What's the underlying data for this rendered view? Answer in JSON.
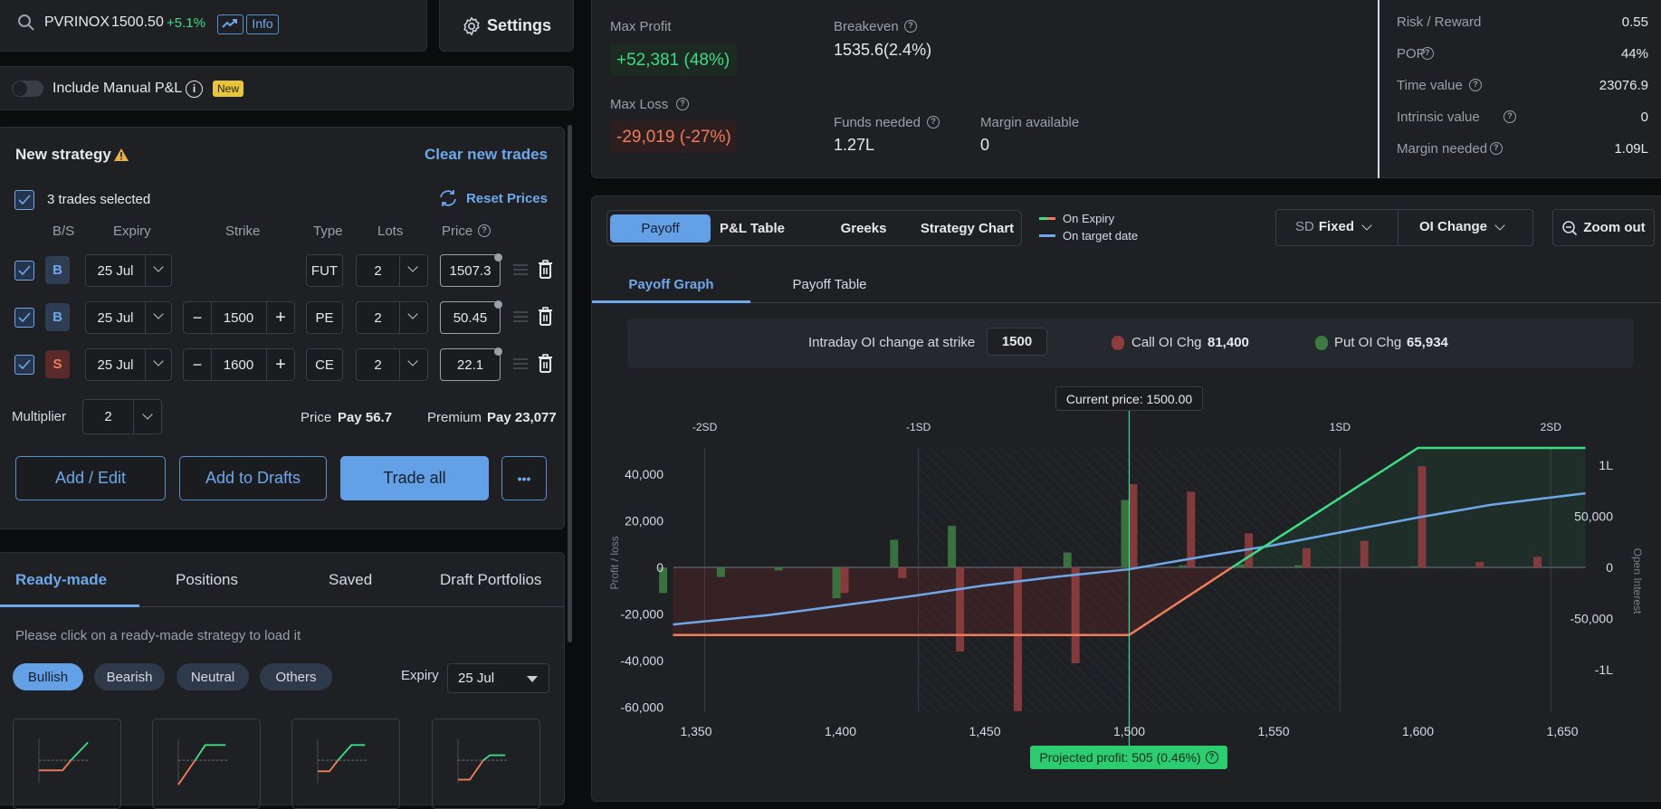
{
  "search": {
    "symbol": "PVRINOX",
    "price": "1500.50",
    "change": "+5.1%",
    "info_label": "Info"
  },
  "settings": {
    "label": "Settings"
  },
  "manual_pl": {
    "label": "Include Manual P&L",
    "badge": "New",
    "enabled": false
  },
  "strategy": {
    "title": "New strategy",
    "clear_label": "Clear new trades",
    "selected_label": "3 trades selected",
    "reset_label": "Reset Prices",
    "headers": [
      "B/S",
      "Expiry",
      "Strike",
      "Type",
      "Lots",
      "Price"
    ],
    "legs": [
      {
        "side": "B",
        "expiry": "25 Jul",
        "strike": "",
        "type": "FUT",
        "lots": "2",
        "price": "1507.3"
      },
      {
        "side": "B",
        "expiry": "25 Jul",
        "strike": "1500",
        "type": "PE",
        "lots": "2",
        "price": "50.45"
      },
      {
        "side": "S",
        "expiry": "25 Jul",
        "strike": "1600",
        "type": "CE",
        "lots": "2",
        "price": "22.1"
      }
    ],
    "multiplier_label": "Multiplier",
    "multiplier": "2",
    "price_label": "Price",
    "price_value": "Pay 56.7",
    "premium_label": "Premium",
    "premium_value": "Pay 23,077",
    "buttons": {
      "add_edit": "Add / Edit",
      "drafts": "Add to Drafts",
      "trade_all": "Trade all",
      "more": "•••"
    }
  },
  "readymade": {
    "tabs": [
      "Ready-made",
      "Positions",
      "Saved",
      "Draft Portfolios"
    ],
    "active_tab": 0,
    "hint": "Please click on a ready-made strategy to load it",
    "filters": [
      "Bullish",
      "Bearish",
      "Neutral",
      "Others"
    ],
    "active_filter": 0,
    "expiry_label": "Expiry",
    "expiry_value": "25 Jul"
  },
  "stats": {
    "max_profit_label": "Max Profit",
    "max_profit": "+52,381 (48%)",
    "max_loss_label": "Max Loss",
    "max_loss": "-29,019 (-27%)",
    "breakeven_label": "Breakeven",
    "breakeven": "1535.6(2.4%)",
    "funds_label": "Funds needed",
    "funds": "1.27L",
    "margin_avail_label": "Margin available",
    "margin_avail": "0",
    "right": [
      {
        "label": "Risk / Reward",
        "value": "0.55",
        "help": false
      },
      {
        "label": "POP",
        "value": "44%",
        "help": true
      },
      {
        "label": "Time value",
        "value": "23076.9",
        "help": true
      },
      {
        "label": "Intrinsic value",
        "value": "0",
        "help": true
      },
      {
        "label": "Margin needed",
        "value": "1.09L",
        "help": true
      }
    ]
  },
  "chart_panel": {
    "tabs": [
      "Payoff",
      "P&L Table",
      "Greeks",
      "Strategy Chart"
    ],
    "active_tab": 0,
    "legend": [
      "On Expiry",
      "On target date"
    ],
    "sd_prefix": "SD",
    "sd_value": "Fixed",
    "oi_mode": "OI Change",
    "zoom_label": "Zoom out",
    "subtabs": [
      "Payoff Graph",
      "Payoff Table"
    ],
    "active_subtab": 0,
    "oi_bar": {
      "label": "Intraday OI change at strike",
      "strike": "1500",
      "call_label": "Call OI Chg",
      "call_value": "81,400",
      "put_label": "Put OI Chg",
      "put_value": "65,934"
    },
    "current_price_label": "Current price: 1500.00",
    "projected_label": "Projected profit: 505 (0.46%)"
  },
  "colors": {
    "accent": "#6ea8ea",
    "profit": "#3ddc84",
    "loss": "#f07c5a",
    "target": "#6ea8ea",
    "call_oi": "#8e3d3f",
    "put_oi": "#3c7a41"
  },
  "chart_data": {
    "type": "line",
    "title": "Payoff Graph",
    "xlabel": "",
    "ylabel": "Profit / loss",
    "y2label": "Open Interest",
    "xlim": [
      1342,
      1658
    ],
    "ylim": [
      -62000,
      48000
    ],
    "y2lim": [
      -120000,
      95000
    ],
    "x_ticks": [
      1350,
      1400,
      1450,
      1500,
      1550,
      1600,
      1650
    ],
    "x_tick_labels": [
      "1,350",
      "1,400",
      "1,450",
      "1,500",
      "1,550",
      "1,600",
      "1,650"
    ],
    "y_ticks": [
      40000,
      20000,
      0,
      -20000,
      -40000,
      -60000
    ],
    "y_tick_labels": [
      "40,000",
      "20,000",
      "0",
      "-20,000",
      "-40,000",
      "-60,000"
    ],
    "y2_ticks": [
      100000,
      50000,
      0,
      -50000,
      -100000
    ],
    "y2_tick_labels": [
      "1L",
      "50,000",
      "0",
      "-50,000",
      "-1L"
    ],
    "sd_markers": [
      {
        "label": "-2SD",
        "x": 1353
      },
      {
        "label": "-1SD",
        "x": 1427
      },
      {
        "label": "1SD",
        "x": 1573
      },
      {
        "label": "2SD",
        "x": 1646
      }
    ],
    "current_price": 1500,
    "grid": true,
    "legend_position": "top",
    "series": [
      {
        "name": "On Expiry",
        "points": [
          [
            1342,
            -29019
          ],
          [
            1500,
            -29019
          ],
          [
            1535.6,
            0
          ],
          [
            1600,
            52381
          ],
          [
            1658,
            52381
          ]
        ]
      },
      {
        "name": "On target date",
        "points": [
          [
            1342,
            -24500
          ],
          [
            1375,
            -20500
          ],
          [
            1400,
            -16400
          ],
          [
            1425,
            -12300
          ],
          [
            1450,
            -7700
          ],
          [
            1475,
            -4000
          ],
          [
            1500,
            -800
          ],
          [
            1525,
            4500
          ],
          [
            1550,
            9500
          ],
          [
            1575,
            15500
          ],
          [
            1600,
            21400
          ],
          [
            1625,
            26800
          ],
          [
            1658,
            31800
          ]
        ]
      }
    ],
    "oi_bars": {
      "strikes": [
        1340,
        1360,
        1380,
        1400,
        1420,
        1440,
        1460,
        1480,
        1500,
        1520,
        1540,
        1560,
        1580,
        1600,
        1620,
        1640
      ],
      "put_oi_change": [
        -25000,
        -9400,
        -3000,
        -30200,
        27000,
        40600,
        0,
        14600,
        65934,
        2000,
        3000,
        2000,
        0,
        1000,
        0,
        0
      ],
      "call_oi_change": [
        0,
        0,
        0,
        -25000,
        -10400,
        -82300,
        -140600,
        -93800,
        81400,
        74000,
        33300,
        18800,
        26000,
        99000,
        5200,
        10400
      ]
    }
  }
}
